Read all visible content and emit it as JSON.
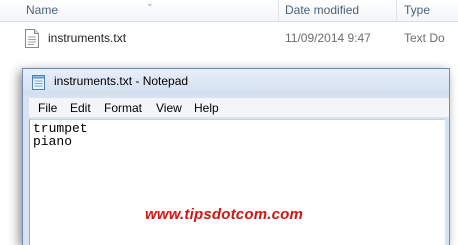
{
  "explorer": {
    "columns": [
      "Name",
      "Date modified",
      "Type"
    ],
    "file": {
      "name": "instruments.txt",
      "date_modified": "11/09/2014 9:47",
      "type": "Text Do",
      "icon": "text-document-icon"
    }
  },
  "notepad": {
    "title": "instruments.txt - Notepad",
    "icon": "notepad-icon",
    "menu": [
      "File",
      "Edit",
      "Format",
      "View",
      "Help"
    ],
    "content": "trumpet\npiano"
  },
  "watermark": "www.tipsdotcom.com",
  "colors": {
    "watermark": "#d41414",
    "window_frame": "#d7e3f1"
  }
}
